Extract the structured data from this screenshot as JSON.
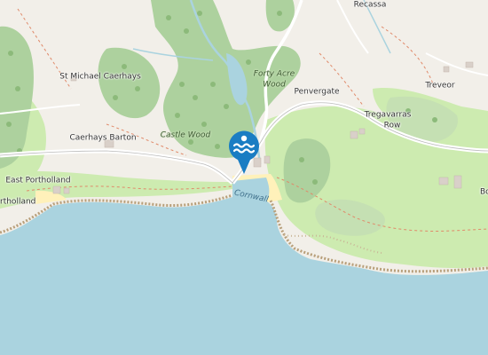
{
  "map": {
    "labels": {
      "recassa": "Recassa",
      "st_michael": "St Michael Caerhays",
      "forty_acre_1": "Forty Acre",
      "forty_acre_2": "Wood",
      "penvergate": "Penvergate",
      "treveor": "Treveor",
      "caerhays_barton": "Caerhays Barton",
      "castle_wood": "Castle Wood",
      "tregavarras_1": "Tregavarras",
      "tregavarras_2": "Row",
      "east_portholland": "East Portholland",
      "portholland": "rtholland",
      "cornwall": "Cornwall",
      "edge_b": "Bo"
    },
    "marker": {
      "icon": "swimming-water-icon",
      "color": "#1a7dc3"
    },
    "colors": {
      "sea": "#aad3df",
      "land": "#f2efe9",
      "wood": "#add19e",
      "grass": "#cdebb0",
      "beach": "#fff1ba",
      "cliff": "#c0a887"
    }
  }
}
